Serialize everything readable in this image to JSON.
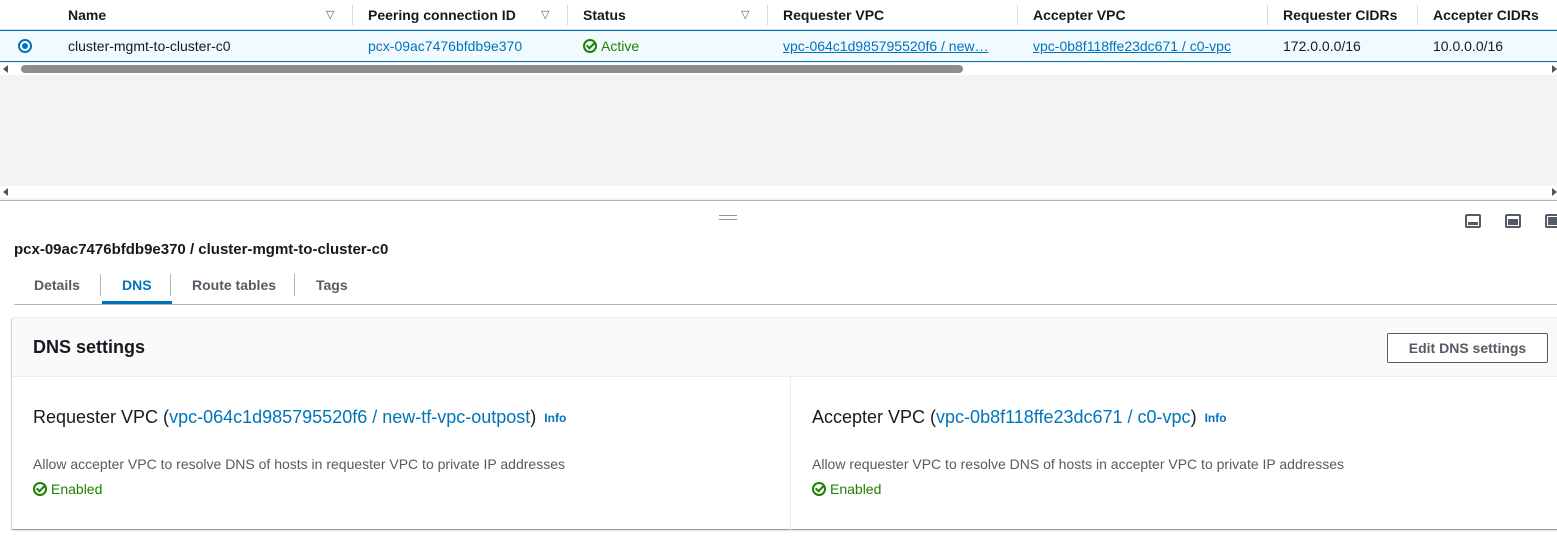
{
  "table": {
    "columns": [
      {
        "label": "Name",
        "sortable": true
      },
      {
        "label": "Peering connection ID",
        "sortable": true
      },
      {
        "label": "Status",
        "sortable": true
      },
      {
        "label": "Requester VPC",
        "sortable": false
      },
      {
        "label": "Accepter VPC",
        "sortable": false
      },
      {
        "label": "Requester CIDRs",
        "sortable": false
      },
      {
        "label": "Accepter CIDRs",
        "sortable": false
      }
    ],
    "rows": [
      {
        "selected": true,
        "name": "cluster-mgmt-to-cluster-c0",
        "peering_id": "pcx-09ac7476bfdb9e370",
        "status": "Active",
        "requester_vpc": "vpc-064c1d985795520f6 / new…",
        "accepter_vpc": "vpc-0b8f118ffe23dc671 / c0-vpc",
        "requester_cidrs": "172.0.0.0/16",
        "accepter_cidrs": "10.0.0.0/16"
      }
    ]
  },
  "details": {
    "title": "pcx-09ac7476bfdb9e370 / cluster-mgmt-to-cluster-c0",
    "tabs": [
      {
        "label": "Details",
        "active": false
      },
      {
        "label": "DNS",
        "active": true
      },
      {
        "label": "Route tables",
        "active": false
      },
      {
        "label": "Tags",
        "active": false
      }
    ],
    "dns": {
      "heading": "DNS settings",
      "edit_button": "Edit DNS settings",
      "requester": {
        "title_prefix": "Requester VPC (",
        "vpc_link": "vpc-064c1d985795520f6 / new-tf-vpc-outpost",
        "title_suffix": ")",
        "info": "Info",
        "description": "Allow accepter VPC to resolve DNS of hosts in requester VPC to private IP addresses",
        "status": "Enabled"
      },
      "accepter": {
        "title_prefix": "Accepter VPC (",
        "vpc_link": "vpc-0b8f118ffe23dc671 / c0-vpc",
        "title_suffix": ")",
        "info": "Info",
        "description": "Allow requester VPC to resolve DNS of hosts in accepter VPC to private IP addresses",
        "status": "Enabled"
      }
    }
  },
  "colors": {
    "link": "#0073bb",
    "success": "#1d8102",
    "selected_row_bg": "#f1faff"
  },
  "icons": {
    "sort": "caret-down-icon",
    "status_ok": "check-circle-icon",
    "pane_controls": [
      "pane-bottom-small-icon",
      "pane-bottom-medium-icon",
      "pane-bottom-full-icon"
    ]
  }
}
